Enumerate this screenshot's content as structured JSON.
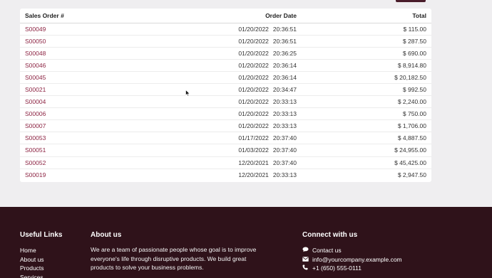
{
  "table": {
    "columns": {
      "order": "Sales Order #",
      "date": "Order Date",
      "total": "Total"
    },
    "rows": [
      {
        "order": "S00049",
        "date": "01/20/2022",
        "time": "20:36:51",
        "total": "$ 115.00"
      },
      {
        "order": "S00050",
        "date": "01/20/2022",
        "time": "20:36:51",
        "total": "$ 287.50"
      },
      {
        "order": "S00048",
        "date": "01/20/2022",
        "time": "20:36:25",
        "total": "$ 690.00"
      },
      {
        "order": "S00046",
        "date": "01/20/2022",
        "time": "20:36:14",
        "total": "$ 8,914.80"
      },
      {
        "order": "S00045",
        "date": "01/20/2022",
        "time": "20:36:14",
        "total": "$ 20,182.50"
      },
      {
        "order": "S00021",
        "date": "01/20/2022",
        "time": "20:34:47",
        "total": "$ 992.50"
      },
      {
        "order": "S00004",
        "date": "01/20/2022",
        "time": "20:33:13",
        "total": "$ 2,240.00"
      },
      {
        "order": "S00006",
        "date": "01/20/2022",
        "time": "20:33:13",
        "total": "$ 750.00"
      },
      {
        "order": "S00007",
        "date": "01/20/2022",
        "time": "20:33:13",
        "total": "$ 1,706.00"
      },
      {
        "order": "S00053",
        "date": "01/17/2022",
        "time": "20:37:40",
        "total": "$ 4,887.50"
      },
      {
        "order": "S00051",
        "date": "01/03/2022",
        "time": "20:37:40",
        "total": "$ 24,955.00"
      },
      {
        "order": "S00052",
        "date": "12/20/2021",
        "time": "20:37:40",
        "total": "$ 45,425.00"
      },
      {
        "order": "S00019",
        "date": "12/20/2021",
        "time": "20:33:13",
        "total": "$ 2,947.50"
      }
    ]
  },
  "footer": {
    "useful_links": {
      "title": "Useful Links",
      "items": [
        "Home",
        "About us",
        "Products",
        "Services"
      ]
    },
    "about": {
      "title": "About us",
      "text": "We are a team of passionate people whose goal is to improve everyone's life through disruptive products. We build great products to solve your business problems."
    },
    "connect": {
      "title": "Connect with us",
      "items": [
        {
          "icon": "chat-icon",
          "text": "Contact us"
        },
        {
          "icon": "envelope-icon",
          "text": "info@yourcompany.example.com"
        },
        {
          "icon": "phone-icon",
          "text": "+1 (650) 555-0111"
        }
      ]
    }
  },
  "colors": {
    "link": "#8c2342",
    "footer_bg": "#2f121a",
    "page_bg": "#efeef0"
  }
}
